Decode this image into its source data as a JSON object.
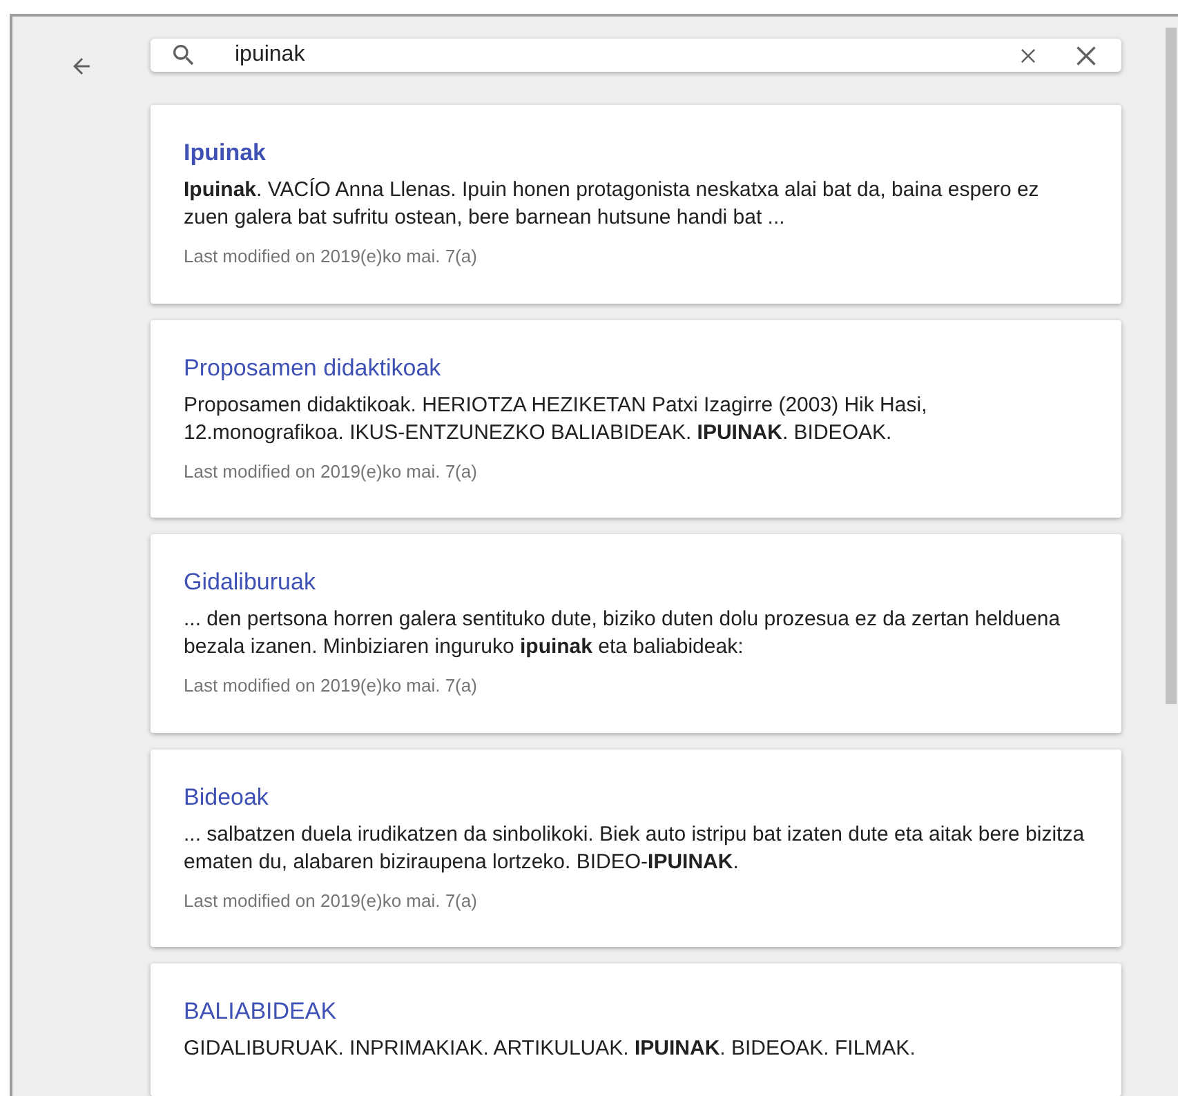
{
  "search": {
    "value": "ipuinak"
  },
  "results": [
    {
      "title": "Ipuinak",
      "emphasized": true,
      "snippet": "**Ipuinak**. VACÍO Anna Llenas. Ipuin honen protagonista neskatxa alai bat da, baina espero ez zuen galera bat sufritu ostean, bere barnean hutsune handi bat  ...",
      "meta": "Last modified on 2019(e)ko mai. 7(a)"
    },
    {
      "title": "Proposamen didaktikoak",
      "emphasized": false,
      "snippet": "Proposamen didaktikoak. HERIOTZA HEZIKETAN Patxi Izagirre (2003) Hik Hasi, 12.monografikoa. IKUS-ENTZUNEZKO BALIABIDEAK. **IPUINAK**. BIDEOAK.",
      "meta": "Last modified on 2019(e)ko mai. 7(a)"
    },
    {
      "title": "Gidaliburuak",
      "emphasized": false,
      "snippet": "... den pertsona horren galera sentituko dute, biziko duten dolu prozesua ez da zertan helduena bezala izanen. Minbiziaren inguruko **ipuinak** eta baliabideak:",
      "meta": "Last modified on 2019(e)ko mai. 7(a)"
    },
    {
      "title": "Bideoak",
      "emphasized": false,
      "snippet": "... salbatzen duela irudikatzen da sinbolikoki. Biek auto istripu bat izaten dute eta aitak bere bizitza ematen du, alabaren biziraupena lortzeko. BIDEO-**IPUINAK**.",
      "meta": "Last modified on 2019(e)ko mai. 7(a)"
    },
    {
      "title": "BALIABIDEAK",
      "emphasized": false,
      "snippet": "GIDALIBURUAK. INPRIMAKIAK. ARTIKULUAK. **IPUINAK**. BIDEOAK. FILMAK."
    }
  ]
}
